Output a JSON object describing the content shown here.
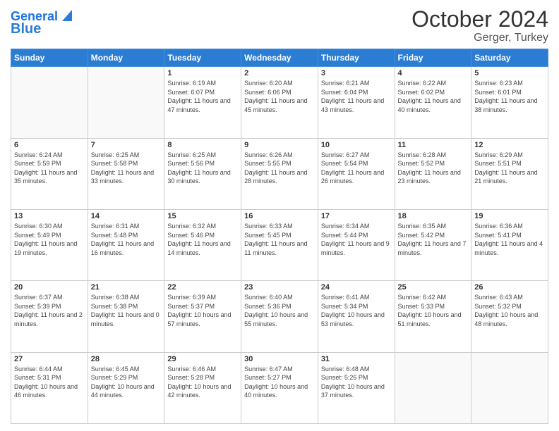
{
  "header": {
    "logo_line1": "General",
    "logo_line2": "Blue",
    "title": "October 2024",
    "subtitle": "Gerger, Turkey"
  },
  "days_of_week": [
    "Sunday",
    "Monday",
    "Tuesday",
    "Wednesday",
    "Thursday",
    "Friday",
    "Saturday"
  ],
  "weeks": [
    [
      {
        "day": "",
        "sunrise": "",
        "sunset": "",
        "daylight": ""
      },
      {
        "day": "",
        "sunrise": "",
        "sunset": "",
        "daylight": ""
      },
      {
        "day": "1",
        "sunrise": "Sunrise: 6:19 AM",
        "sunset": "Sunset: 6:07 PM",
        "daylight": "Daylight: 11 hours and 47 minutes."
      },
      {
        "day": "2",
        "sunrise": "Sunrise: 6:20 AM",
        "sunset": "Sunset: 6:06 PM",
        "daylight": "Daylight: 11 hours and 45 minutes."
      },
      {
        "day": "3",
        "sunrise": "Sunrise: 6:21 AM",
        "sunset": "Sunset: 6:04 PM",
        "daylight": "Daylight: 11 hours and 43 minutes."
      },
      {
        "day": "4",
        "sunrise": "Sunrise: 6:22 AM",
        "sunset": "Sunset: 6:02 PM",
        "daylight": "Daylight: 11 hours and 40 minutes."
      },
      {
        "day": "5",
        "sunrise": "Sunrise: 6:23 AM",
        "sunset": "Sunset: 6:01 PM",
        "daylight": "Daylight: 11 hours and 38 minutes."
      }
    ],
    [
      {
        "day": "6",
        "sunrise": "Sunrise: 6:24 AM",
        "sunset": "Sunset: 5:59 PM",
        "daylight": "Daylight: 11 hours and 35 minutes."
      },
      {
        "day": "7",
        "sunrise": "Sunrise: 6:25 AM",
        "sunset": "Sunset: 5:58 PM",
        "daylight": "Daylight: 11 hours and 33 minutes."
      },
      {
        "day": "8",
        "sunrise": "Sunrise: 6:25 AM",
        "sunset": "Sunset: 5:56 PM",
        "daylight": "Daylight: 11 hours and 30 minutes."
      },
      {
        "day": "9",
        "sunrise": "Sunrise: 6:26 AM",
        "sunset": "Sunset: 5:55 PM",
        "daylight": "Daylight: 11 hours and 28 minutes."
      },
      {
        "day": "10",
        "sunrise": "Sunrise: 6:27 AM",
        "sunset": "Sunset: 5:54 PM",
        "daylight": "Daylight: 11 hours and 26 minutes."
      },
      {
        "day": "11",
        "sunrise": "Sunrise: 6:28 AM",
        "sunset": "Sunset: 5:52 PM",
        "daylight": "Daylight: 11 hours and 23 minutes."
      },
      {
        "day": "12",
        "sunrise": "Sunrise: 6:29 AM",
        "sunset": "Sunset: 5:51 PM",
        "daylight": "Daylight: 11 hours and 21 minutes."
      }
    ],
    [
      {
        "day": "13",
        "sunrise": "Sunrise: 6:30 AM",
        "sunset": "Sunset: 5:49 PM",
        "daylight": "Daylight: 11 hours and 19 minutes."
      },
      {
        "day": "14",
        "sunrise": "Sunrise: 6:31 AM",
        "sunset": "Sunset: 5:48 PM",
        "daylight": "Daylight: 11 hours and 16 minutes."
      },
      {
        "day": "15",
        "sunrise": "Sunrise: 6:32 AM",
        "sunset": "Sunset: 5:46 PM",
        "daylight": "Daylight: 11 hours and 14 minutes."
      },
      {
        "day": "16",
        "sunrise": "Sunrise: 6:33 AM",
        "sunset": "Sunset: 5:45 PM",
        "daylight": "Daylight: 11 hours and 11 minutes."
      },
      {
        "day": "17",
        "sunrise": "Sunrise: 6:34 AM",
        "sunset": "Sunset: 5:44 PM",
        "daylight": "Daylight: 11 hours and 9 minutes."
      },
      {
        "day": "18",
        "sunrise": "Sunrise: 6:35 AM",
        "sunset": "Sunset: 5:42 PM",
        "daylight": "Daylight: 11 hours and 7 minutes."
      },
      {
        "day": "19",
        "sunrise": "Sunrise: 6:36 AM",
        "sunset": "Sunset: 5:41 PM",
        "daylight": "Daylight: 11 hours and 4 minutes."
      }
    ],
    [
      {
        "day": "20",
        "sunrise": "Sunrise: 6:37 AM",
        "sunset": "Sunset: 5:39 PM",
        "daylight": "Daylight: 11 hours and 2 minutes."
      },
      {
        "day": "21",
        "sunrise": "Sunrise: 6:38 AM",
        "sunset": "Sunset: 5:38 PM",
        "daylight": "Daylight: 11 hours and 0 minutes."
      },
      {
        "day": "22",
        "sunrise": "Sunrise: 6:39 AM",
        "sunset": "Sunset: 5:37 PM",
        "daylight": "Daylight: 10 hours and 57 minutes."
      },
      {
        "day": "23",
        "sunrise": "Sunrise: 6:40 AM",
        "sunset": "Sunset: 5:36 PM",
        "daylight": "Daylight: 10 hours and 55 minutes."
      },
      {
        "day": "24",
        "sunrise": "Sunrise: 6:41 AM",
        "sunset": "Sunset: 5:34 PM",
        "daylight": "Daylight: 10 hours and 53 minutes."
      },
      {
        "day": "25",
        "sunrise": "Sunrise: 6:42 AM",
        "sunset": "Sunset: 5:33 PM",
        "daylight": "Daylight: 10 hours and 51 minutes."
      },
      {
        "day": "26",
        "sunrise": "Sunrise: 6:43 AM",
        "sunset": "Sunset: 5:32 PM",
        "daylight": "Daylight: 10 hours and 48 minutes."
      }
    ],
    [
      {
        "day": "27",
        "sunrise": "Sunrise: 6:44 AM",
        "sunset": "Sunset: 5:31 PM",
        "daylight": "Daylight: 10 hours and 46 minutes."
      },
      {
        "day": "28",
        "sunrise": "Sunrise: 6:45 AM",
        "sunset": "Sunset: 5:29 PM",
        "daylight": "Daylight: 10 hours and 44 minutes."
      },
      {
        "day": "29",
        "sunrise": "Sunrise: 6:46 AM",
        "sunset": "Sunset: 5:28 PM",
        "daylight": "Daylight: 10 hours and 42 minutes."
      },
      {
        "day": "30",
        "sunrise": "Sunrise: 6:47 AM",
        "sunset": "Sunset: 5:27 PM",
        "daylight": "Daylight: 10 hours and 40 minutes."
      },
      {
        "day": "31",
        "sunrise": "Sunrise: 6:48 AM",
        "sunset": "Sunset: 5:26 PM",
        "daylight": "Daylight: 10 hours and 37 minutes."
      },
      {
        "day": "",
        "sunrise": "",
        "sunset": "",
        "daylight": ""
      },
      {
        "day": "",
        "sunrise": "",
        "sunset": "",
        "daylight": ""
      }
    ]
  ]
}
